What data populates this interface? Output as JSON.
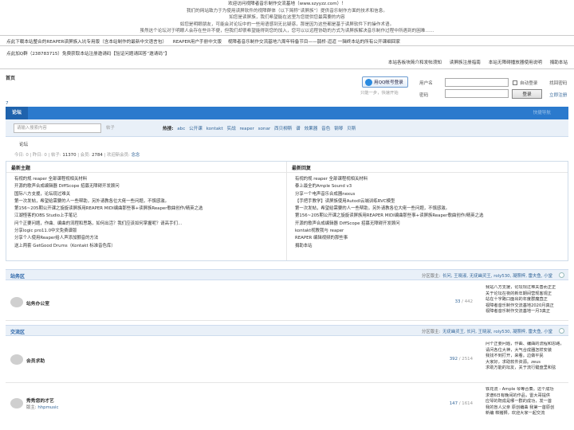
{
  "notice": {
    "line1": "欢迎访问视障者音乐制作交流基地（www.szyyzz.com）！",
    "line2": "我们的网站致力于为使用读屏软件的视障群体（以下简称“读屏族”）提供音乐制作方面的技术和信息。",
    "line3": "如您是读屏族，我们希望能在这里为您提供您最需要的内容",
    "line4": "如您是明眼朋友，可能会对论坛中的一些用语感到无比疑惑，那是因为这些都是基于读屏软件下的操作术语。",
    "line5": "虽然这个论坛对于明眼人会存在些许不便，但我们却很希望能得到您的加入，您可以以远程协助的方式为读屏族解决音乐制作过程中所遇到的困难……"
  },
  "banners": {
    "line1": [
      "点此下载本站整合的REAPER读屏族入坑专用版（含本站制作的最新中文语言包）",
      "REAPER用户手册中文版",
      "视障者音乐制作交流基地六周年特备节目——鹊桥·迢迢  一辑终本站的所有公开课细回家"
    ],
    "line2": "点此加Q群（238783715）免费获取本站注册邀请码【验证问题请回答“邀请码”】"
  },
  "topbar": [
    "本站各板块简介和发帖须知",
    "读屏族注册指南",
    "本站无障碍播放器使用说明",
    "捐助本站"
  ],
  "site": {
    "name": "首页",
    "seven": "7"
  },
  "login": {
    "qq_label": "用QQ帐号登录",
    "qq_sub": "只能一步，快速开始",
    "username_label": "用户名",
    "password_label": "密码",
    "auto_login": "自动登录",
    "forgot": "找回密码",
    "login_btn": "登录",
    "register": "立即注册"
  },
  "nav": {
    "tab": "论坛",
    "right": "快捷导航"
  },
  "search": {
    "placeholder": "请输入搜索内容",
    "select": "帖子",
    "hot_label": "热搜:",
    "hot": [
      "abc",
      "公开课",
      "kontakt",
      "实战",
      "reaper",
      "sonar",
      "西贝柳斯",
      "谱",
      "效果器",
      "音色",
      "钢琴",
      "贝斯"
    ]
  },
  "crumb": "论坛",
  "stats": {
    "today_label": "今日:",
    "today": "0",
    "yesterday_label": "昨日:",
    "yesterday": "0",
    "posts_label": "帖子:",
    "posts": "11370",
    "members_label": "会员:",
    "members": "2784",
    "welcome": "欢迎新会员:",
    "newest": "念念"
  },
  "latest_topics": {
    "title": "最新主题",
    "items": [
      "有视的规 reaper 全部课程视相关材料",
      "开源的歌声合成编辑器 DiffScope 招募无障碍开发顾问",
      "国际八方支援，论坛现过难关",
      "第一次发帖，希望给需要的人一些帮助，另外请教各位大佬一些问题，不慎感激。",
      "第156~205期公开课之旋旋读屏族用REAPER MIDI编曲那些事+读屏族Reaper歌曲创作/精英之选",
      "江湖怪客的OBS Studio上手笔记",
      "问个正要问题，作曲、编曲的流程和思路，如何出活？我们应该如何掌握呢？请高手们…",
      "分享logic pro11.0中文免费谱版",
      "分享个人使用Reaper给人声添加颤音的方法",
      "送上两套 GetGood Drums（Kontakt 标准音色库）"
    ]
  },
  "latest_replies": {
    "title": "最新回复",
    "items": [
      "有视的规 reaper 全部课程视相关材料",
      "泰上最全的Ample Sound v3",
      "分享一个电声音乐合成器nexus",
      "【手把手教学】读屏族使用Autodl云端训练RVC模型",
      "第一次发帖，希望给需要的人一些帮助，另外请教各位大佬一些问题，不慎感激。",
      "第156~205期公开课之旋旋读屏族用REAPER MIDI编曲那些事+读屏族Reaper歌曲创作/精英之选",
      "开源的歌声合成编辑器 DiffScope 招募无障碍开发顾问",
      "kontakt视教我与 reaper",
      "REAPER 编辑视频的那些事",
      "捐助本站"
    ]
  },
  "sections": [
    {
      "title": "站务区",
      "mods_label": "分区版主:",
      "mods": "长问, 王晓淑, 无疣幽灵王, roly530, 凝照梓, 雷夫鱼, 小堂",
      "forums": [
        {
          "name": "站务办公室",
          "mod": "",
          "threads": "33",
          "posts": "442",
          "last": [
            "我站八方支援，论坛现过难关善而正正",
            "关于论坛在夜的新年期间营规客观正",
            "站在十字路口面出的年度群魔直正",
            "视障者音乐制作交流基地2020月真正",
            "视障者音乐制作交流基地一月3真正"
          ]
        }
      ]
    },
    {
      "title": "交流区",
      "mods_label": "分区版主:",
      "mods": "无疣幽灵王, 长问, 王晓淑, roly530, 凝照梓, 雷夫鱼, 小堂",
      "forums": [
        {
          "name": "会员求助",
          "mod": "",
          "threads": "392",
          "posts": "2514",
          "last": [
            "问个正要问题，作曲、编曲的流程和思路，",
            "请问各位大神，大气合成器怎样安装",
            "我找不到打开，来看。边做平民",
            "大家好，求助软件资源。zeus",
            "求助万能的坛友，关于流行键盘里和弦"
          ]
        },
        {
          "name": "秀秀您的才艺",
          "mod_label": "版主:",
          "mod": "hhpmusic",
          "threads": "147",
          "posts": "1614",
          "last": [
            "铁花流 - Ample 琴等合奏。这个成功",
            "求谱6日有晚间的作品，雷大哥提供",
            "应琴的既成是哪一群的成功，发一首",
            "我的盲人父亲 原创编曲 我第一首原创",
            "新编 棉猪狮，欢迎大家一起交流"
          ]
        }
      ]
    }
  ]
}
